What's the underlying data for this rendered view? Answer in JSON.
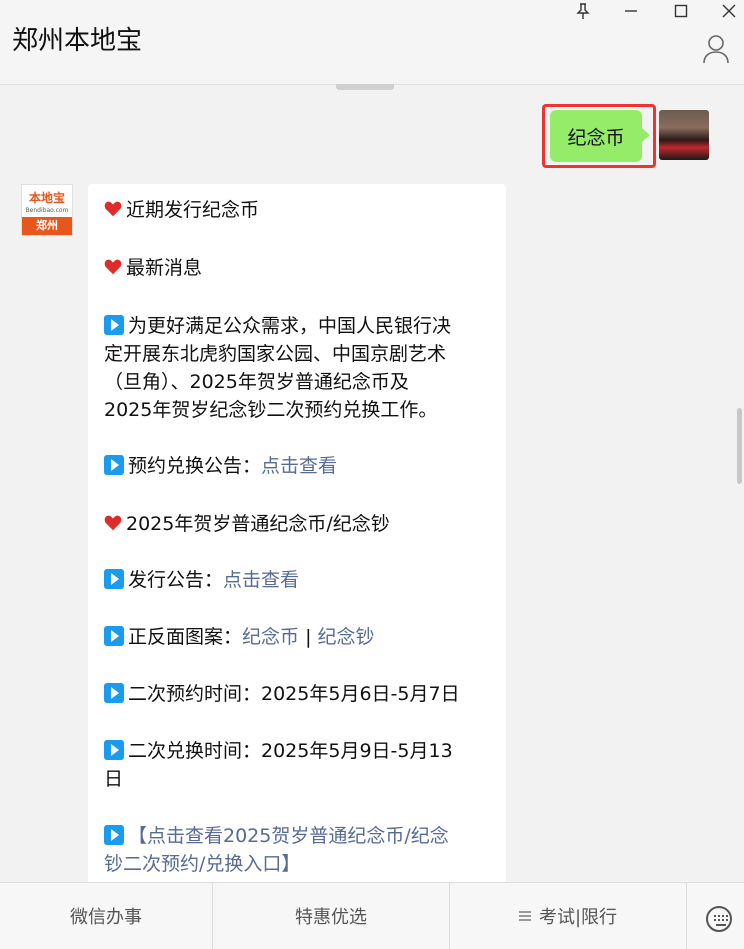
{
  "header": {
    "title": "郑州本地宝"
  },
  "window": {
    "pin_icon": "pin-icon",
    "minimize_icon": "minimize-icon",
    "maximize_icon": "maximize-icon",
    "close_icon": "close-icon",
    "profile_icon": "person-icon"
  },
  "user_message": {
    "text": "纪念币"
  },
  "bot": {
    "avatar_text_top": "本地宝",
    "avatar_text_mid": "Bendibao.com",
    "avatar_text_bottom": "郑州",
    "lines": {
      "l1": "近期发行纪念币",
      "l2": "最新消息",
      "l3a": "为更好满足公众需求，中国人民银行决",
      "l3b": "定开展东北虎豹国家公园、中国京剧艺术",
      "l3c": "（旦角）、2025年贺岁普通纪念币及",
      "l3d": "2025年贺岁纪念钞二次预约兑换工作。",
      "l4_label": "预约兑换公告：",
      "l4_link": "点击查看",
      "l5": "2025年贺岁普通纪念币/纪念钞",
      "l6_label": "发行公告：",
      "l6_link": "点击查看",
      "l7_label": "正反面图案：",
      "l7_link1": "纪念币",
      "l7_sep": " | ",
      "l7_link2": "纪念钞",
      "l8": "二次预约时间：2025年5月6日-5月7日",
      "l9a": "二次兑换时间：2025年5月9日-5月13",
      "l9b": "日",
      "l10a": "【点击查看2025贺岁普通纪念币/纪念",
      "l10b": "钞二次预约/兑换入口】"
    }
  },
  "bottom_menu": {
    "item1": "微信办事",
    "item2": "特惠优选",
    "item3": "考试|限行",
    "keyboard_icon": "keyboard-icon"
  },
  "colors": {
    "bubble_green": "#95ec69",
    "link_blue": "#576b95",
    "highlight_red": "#ee3333",
    "play_blue": "#1a9bf0",
    "heart_red": "#e02b2b"
  }
}
